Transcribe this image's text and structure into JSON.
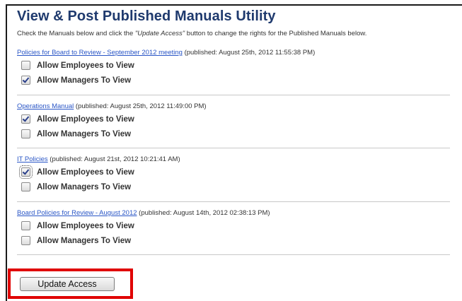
{
  "title": "View & Post Published Manuals Utility",
  "instructions": {
    "before": "Check the Manuals below and click the ",
    "emphasis": "\"Update Access\"",
    "after": " button to change the rights for the Published Manuals below."
  },
  "manuals": [
    {
      "name": "Policies for Board to Review - September 2012 meeting",
      "published": "(published: August 25th, 2012 11:55:38 PM)",
      "employees_label": "Allow Employees to View",
      "employees_checked": false,
      "managers_label": "Allow Managers To View",
      "managers_checked": true
    },
    {
      "name": "Operations Manual",
      "published": "(published: August 25th, 2012 11:49:00 PM)",
      "employees_label": "Allow Employees to View",
      "employees_checked": true,
      "managers_label": "Allow Managers To View",
      "managers_checked": false
    },
    {
      "name": "IT Policies",
      "published": "(published: August 21st, 2012 10:21:41 AM)",
      "employees_label": "Allow Employees to View",
      "employees_checked": true,
      "managers_label": "Allow Managers To View",
      "managers_checked": false
    },
    {
      "name": "Board Policies for Review - August 2012",
      "published": "(published: August 14th, 2012 02:38:13 PM)",
      "employees_label": "Allow Employees to View",
      "employees_checked": false,
      "managers_label": "Allow Managers To View",
      "managers_checked": false
    }
  ],
  "update_button": "Update Access",
  "colors": {
    "title": "#1f3a6e",
    "link": "#2a56c6",
    "highlight": "#e00000"
  }
}
